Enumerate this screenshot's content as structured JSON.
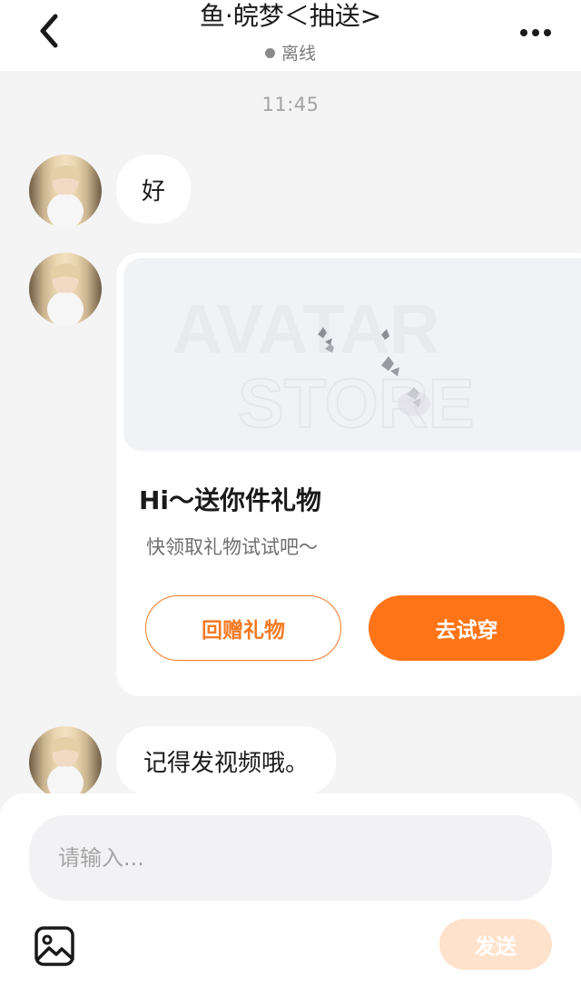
{
  "header": {
    "title": "鱼·皖梦＜抽送>",
    "status": "离线",
    "back_icon": "chevron-left-icon",
    "more_icon": "more-horizontal-icon"
  },
  "messages": {
    "timestamp": "11:45",
    "text_1": "好",
    "gift": {
      "title": "Hi～送你件礼物",
      "subtitle": "快领取礼物试试吧～",
      "return_gift_label": "回赠礼物",
      "try_on_label": "去试穿",
      "watermark_line_1": "AVATAR",
      "watermark_line_2": "STORE"
    },
    "text_3": "记得发视频哦。"
  },
  "composer": {
    "placeholder": "请输入...",
    "send_label": "发送",
    "image_icon": "image-icon"
  },
  "colors": {
    "accent": "#ff7417",
    "accent_outline": "#f37a25",
    "send_disabled": "#ffe2cc",
    "background": "#f4f4f4"
  }
}
